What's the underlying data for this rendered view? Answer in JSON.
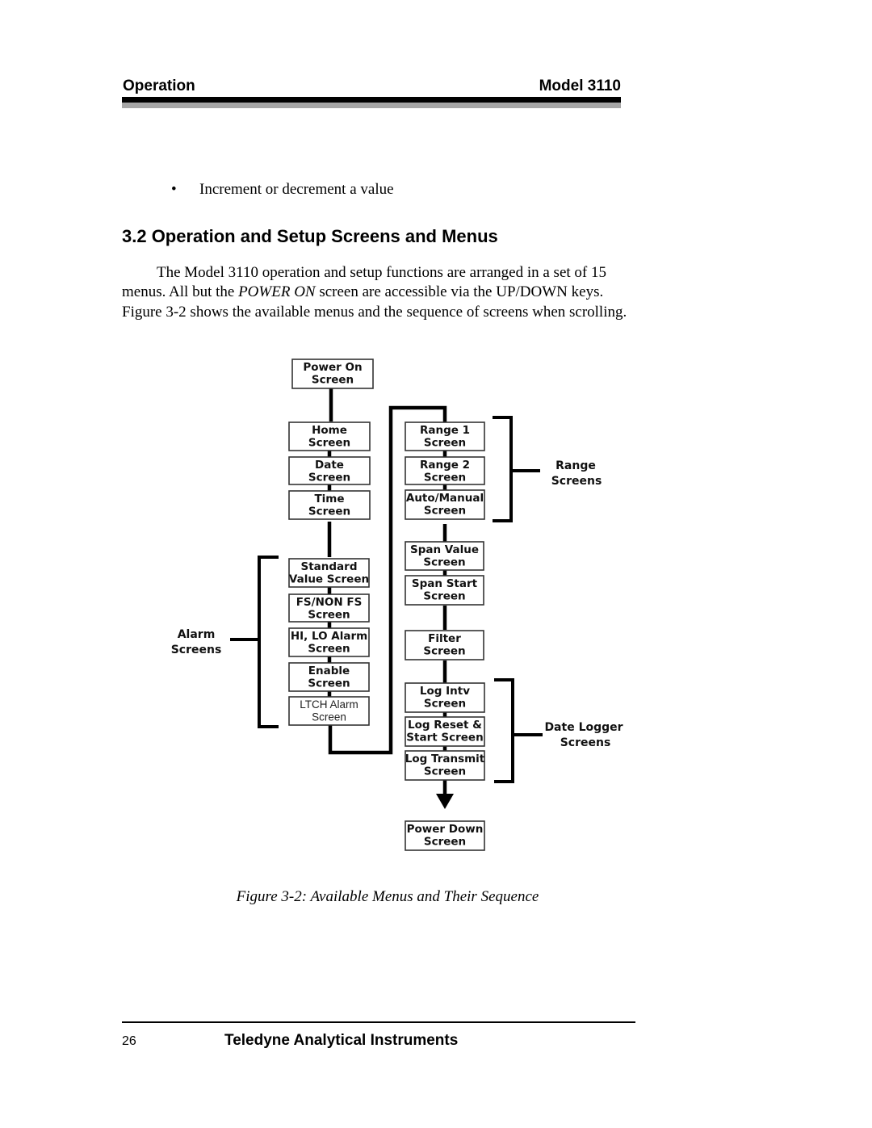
{
  "header": {
    "section": "Operation",
    "model": "Model 3110"
  },
  "bullets": [
    "Increment or decrement a value"
  ],
  "bullet_glyph": "•",
  "section": {
    "title": "3.2 Operation and Setup Screens and Menus",
    "paragraph_parts": [
      "The Model 3110 operation and setup functions are arranged in a set of 15 menus. All but the ",
      "POWER ON",
      " screen are accessible via the UP/DOWN keys. Figure 3-2 shows the available menus and the sequence of screens when scrolling."
    ]
  },
  "diagram": {
    "boxes": {
      "power_on": [
        "Power On",
        "Screen"
      ],
      "home": [
        "Home",
        "Screen"
      ],
      "date": [
        "Date",
        "Screen"
      ],
      "time": [
        "Time",
        "Screen"
      ],
      "standard_value": [
        "Standard",
        "Value Screen"
      ],
      "fs_non_fs": [
        "FS/NON FS",
        "Screen"
      ],
      "hi_lo_alarm": [
        "HI, LO Alarm",
        "Screen"
      ],
      "enable": [
        "Enable",
        "Screen"
      ],
      "ltch_alarm": [
        "LTCH Alarm",
        "Screen"
      ],
      "range1": [
        "Range 1",
        "Screen"
      ],
      "range2": [
        "Range 2",
        "Screen"
      ],
      "auto_manual": [
        "Auto/Manual",
        "Screen"
      ],
      "span_value": [
        "Span Value",
        "Screen"
      ],
      "span_start": [
        "Span Start",
        "Screen"
      ],
      "filter": [
        "Filter",
        "Screen"
      ],
      "log_intv": [
        "Log Intv",
        "Screen"
      ],
      "log_reset": [
        "Log Reset &",
        "Start Screen"
      ],
      "log_transmit": [
        "Log Transmit",
        "Screen"
      ],
      "power_down": [
        "Power Down",
        "Screen"
      ]
    },
    "groups": {
      "range": [
        "Range",
        "Screens"
      ],
      "alarm": [
        "Alarm",
        "Screens"
      ],
      "logger": [
        "Date Logger",
        "Screens"
      ]
    }
  },
  "caption": "Figure 3-2: Available Menus and Their Sequence",
  "footer": {
    "page_number": "26",
    "publisher": "Teledyne Analytical Instruments"
  }
}
